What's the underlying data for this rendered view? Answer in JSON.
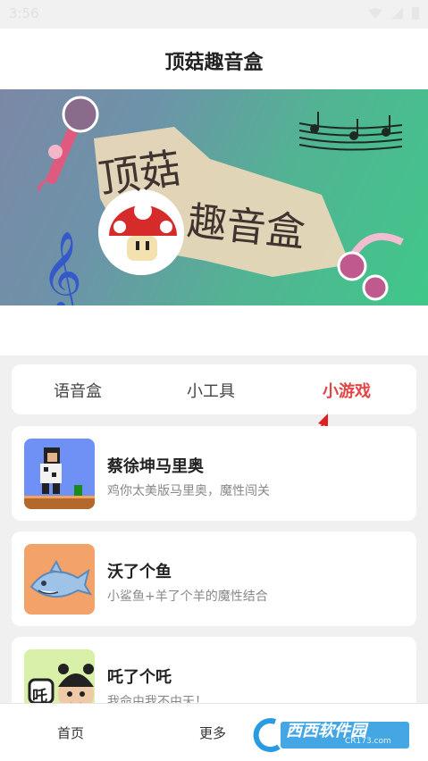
{
  "status": {
    "time": "3:56"
  },
  "app": {
    "title": "顶菇趣音盒"
  },
  "banner": {
    "line1": "顶菇",
    "line2": "趣音盒"
  },
  "tabs": [
    {
      "label": "语音盒",
      "active": false
    },
    {
      "label": "小工具",
      "active": false
    },
    {
      "label": "小游戏",
      "active": true
    }
  ],
  "games": [
    {
      "name": "蔡徐坤马里奥",
      "desc": "鸡你太美版马里奥，魔性闯关"
    },
    {
      "name": "沃了个鱼",
      "desc": "小鲨鱼+羊了个羊的魔性结合"
    },
    {
      "name": "吒了个吒",
      "desc": "我命由我不由天！",
      "thumb_text": "吒"
    }
  ],
  "bottom_nav": [
    {
      "label": "首页"
    },
    {
      "label": "更多"
    }
  ],
  "watermark": {
    "brand": "西西软件园",
    "url": "CR173.com"
  },
  "colors": {
    "accent": "#e34545",
    "banner_left": "#7b88a6",
    "banner_right": "#40c78a"
  }
}
